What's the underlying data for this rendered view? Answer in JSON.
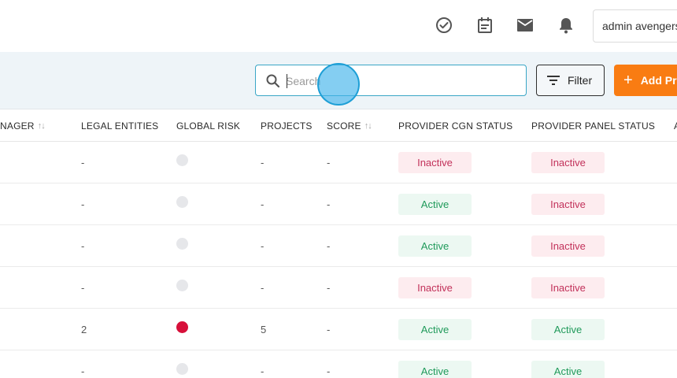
{
  "header": {
    "user_label": "admin avengers",
    "icons": [
      "check-circle-icon",
      "calendar-icon",
      "mail-icon",
      "bell-icon"
    ]
  },
  "toolbar": {
    "search_placeholder": "Search",
    "search_value": "",
    "filter_label": "Filter",
    "add_label": "Add Provider"
  },
  "table": {
    "columns": [
      {
        "label": "NAGER",
        "sortable": true
      },
      {
        "label": "LEGAL ENTITIES",
        "sortable": false
      },
      {
        "label": "GLOBAL RISK",
        "sortable": false
      },
      {
        "label": "PROJECTS",
        "sortable": false
      },
      {
        "label": "SCORE",
        "sortable": true
      },
      {
        "label": "PROVIDER CGN STATUS",
        "sortable": false
      },
      {
        "label": "PROVIDER PANEL STATUS",
        "sortable": false
      },
      {
        "label": "A",
        "sortable": false
      }
    ],
    "rows": [
      {
        "legal_entities": "-",
        "risk": "none",
        "projects": "-",
        "score": "-",
        "cgn_status": "Inactive",
        "panel_status": "Inactive"
      },
      {
        "legal_entities": "-",
        "risk": "none",
        "projects": "-",
        "score": "-",
        "cgn_status": "Active",
        "panel_status": "Inactive"
      },
      {
        "legal_entities": "-",
        "risk": "none",
        "projects": "-",
        "score": "-",
        "cgn_status": "Active",
        "panel_status": "Inactive"
      },
      {
        "legal_entities": "-",
        "risk": "none",
        "projects": "-",
        "score": "-",
        "cgn_status": "Inactive",
        "panel_status": "Inactive"
      },
      {
        "legal_entities": "2",
        "risk": "high",
        "projects": "5",
        "score": "-",
        "cgn_status": "Active",
        "panel_status": "Active"
      },
      {
        "legal_entities": "-",
        "risk": "none",
        "projects": "-",
        "score": "-",
        "cgn_status": "Active",
        "panel_status": "Active"
      }
    ]
  },
  "colors": {
    "accent": "#f97c12",
    "search_border": "#3aa6c6",
    "active_text": "#1f9a5a",
    "inactive_text": "#c2315a",
    "risk_high": "#d7103a"
  }
}
